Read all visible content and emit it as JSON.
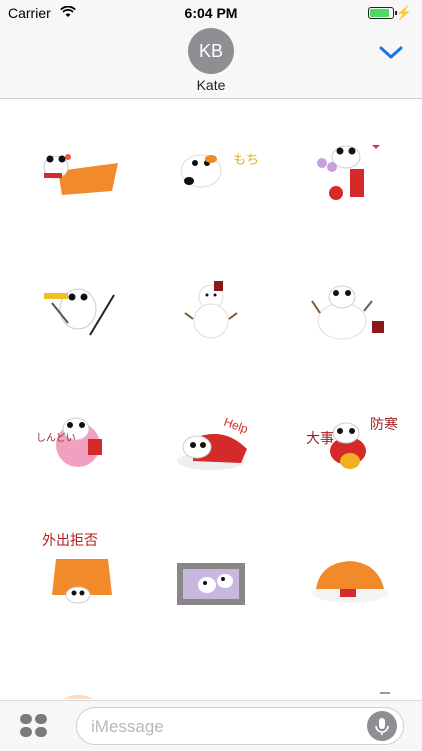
{
  "status": {
    "carrier": "Carrier",
    "time": "6:04 PM"
  },
  "header": {
    "initials": "KB",
    "name": "Kate"
  },
  "stickers": {
    "mochi_text": "もち",
    "help_text": "Help",
    "dai_text": "大事",
    "bousai_text": "防寒",
    "sign_text": "外出拒否",
    "tired_text": "しんどい"
  },
  "input": {
    "placeholder": "iMessage"
  },
  "colors": {
    "accent": "#1a73e8",
    "battery": "#4cd964",
    "sticker_orange": "#f08a2a",
    "sticker_red": "#d42a2a"
  }
}
